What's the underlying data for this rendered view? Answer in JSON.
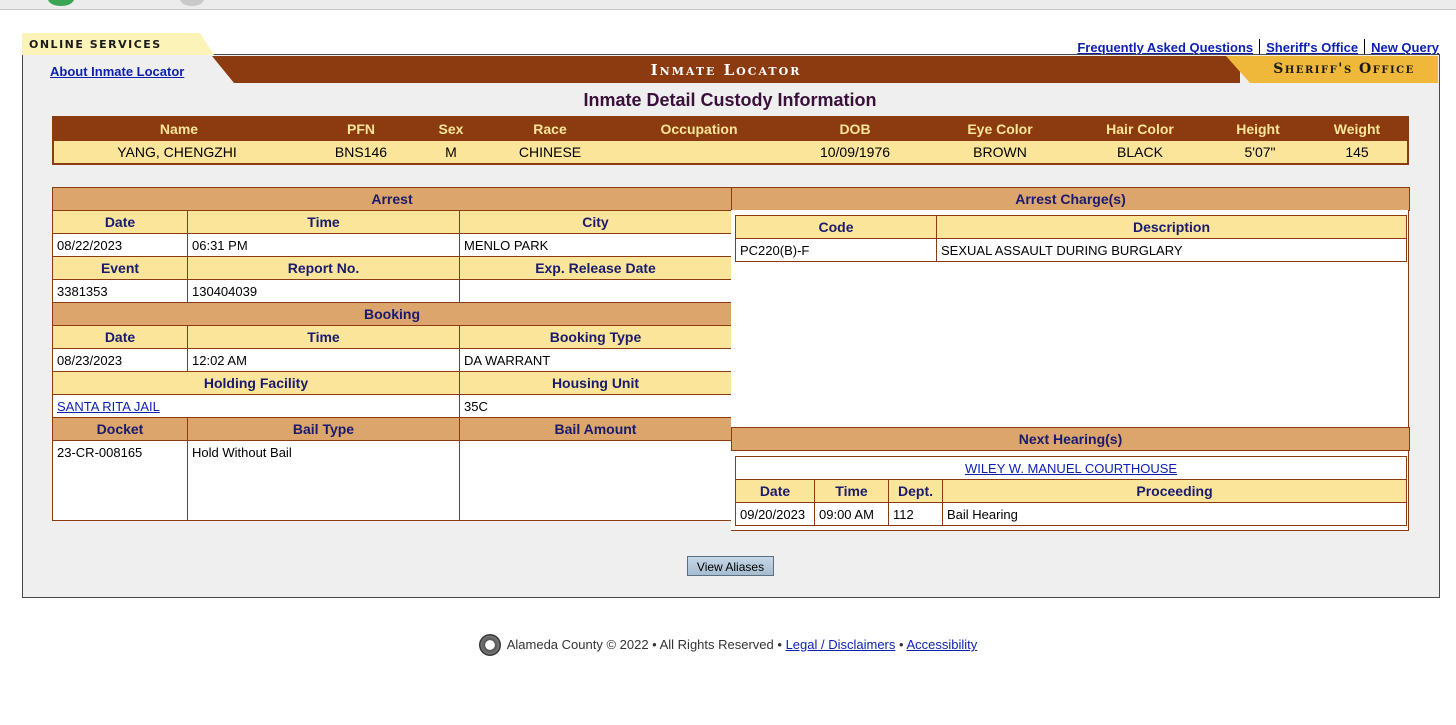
{
  "tabs": {
    "online_services": "ONLINE SERVICES",
    "about": "About Inmate Locator"
  },
  "top_links": [
    "Frequently Asked Questions",
    "Sheriff's Office",
    "New Query"
  ],
  "banner": {
    "title": "Inmate Locator",
    "sheriff": "Sheriff's Office"
  },
  "page_title": "Inmate Detail Custody Information",
  "summary": {
    "headers": [
      "Name",
      "PFN",
      "Sex",
      "Race",
      "Occupation",
      "DOB",
      "Eye Color",
      "Hair Color",
      "Height",
      "Weight"
    ],
    "values": [
      "YANG, CHENGZHI",
      "BNS146",
      "M",
      "CHINESE",
      "",
      "10/09/1976",
      "BROWN",
      "BLACK",
      "5'07\"",
      "145"
    ]
  },
  "arrest": {
    "title": "Arrest",
    "h1": [
      "Date",
      "Time",
      "City"
    ],
    "v1": [
      "08/22/2023",
      "06:31 PM",
      "MENLO PARK"
    ],
    "h2": [
      "Event",
      "Report No.",
      "Exp. Release Date"
    ],
    "v2": [
      "3381353",
      "130404039",
      ""
    ]
  },
  "booking": {
    "title": "Booking",
    "h1": [
      "Date",
      "Time",
      "Booking Type"
    ],
    "v1": [
      "08/23/2023",
      "12:02 AM",
      "DA WARRANT"
    ],
    "h2": [
      "Holding Facility",
      "Housing Unit"
    ],
    "v2": [
      "SANTA RITA JAIL ",
      "35C"
    ]
  },
  "bail": {
    "headers": [
      "Docket",
      "Bail Type",
      "Bail Amount"
    ],
    "values": [
      "23-CR-008165",
      "Hold Without Bail",
      ""
    ]
  },
  "charges": {
    "title": "Arrest Charge(s)",
    "headers": [
      "Code",
      "Description"
    ],
    "rows": [
      [
        "PC220(B)-F",
        "SEXUAL ASSAULT DURING BURGLARY"
      ]
    ]
  },
  "hearings": {
    "title": "Next Hearing(s)",
    "court": "WILEY W. MANUEL COURTHOUSE",
    "headers": [
      "Date",
      "Time",
      "Dept.",
      "Proceeding"
    ],
    "rows": [
      [
        "09/20/2023",
        "09:00 AM",
        "112",
        "Bail Hearing"
      ]
    ]
  },
  "buttons": {
    "view_aliases": "View Aliases"
  },
  "footer": {
    "text": "Alameda County © 2022 • All Rights Reserved •",
    "legal": "Legal / Disclaimers",
    "bullet": "•",
    "accessibility": "Accessibility"
  }
}
